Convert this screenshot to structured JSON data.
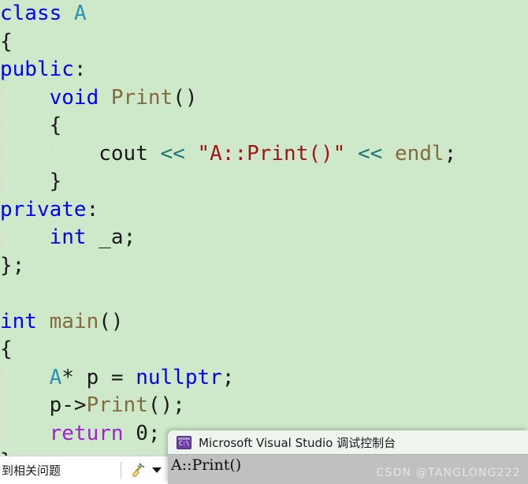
{
  "editor": {
    "background_color": "#cee9ca",
    "font_size_px": 26,
    "line_height_px": 35.5,
    "lines": [
      {
        "indent": 0,
        "tokens": [
          {
            "text": "class",
            "cls": "t-kw"
          },
          {
            "text": " ",
            "cls": "t-plain"
          },
          {
            "text": "A",
            "cls": "t-type"
          }
        ]
      },
      {
        "indent": 0,
        "tokens": [
          {
            "text": "{",
            "cls": "t-plain"
          }
        ]
      },
      {
        "indent": 0,
        "tokens": [
          {
            "text": "public",
            "cls": "t-kw"
          },
          {
            "text": ":",
            "cls": "t-plain"
          }
        ]
      },
      {
        "indent": 1,
        "tokens": [
          {
            "text": "void",
            "cls": "t-kw"
          },
          {
            "text": " ",
            "cls": "t-plain"
          },
          {
            "text": "Print",
            "cls": "t-fn"
          },
          {
            "text": "()",
            "cls": "t-plain"
          }
        ]
      },
      {
        "indent": 1,
        "tokens": [
          {
            "text": "{",
            "cls": "t-plain"
          }
        ]
      },
      {
        "indent": 2,
        "tokens": [
          {
            "text": "cout",
            "cls": "t-plain"
          },
          {
            "text": " ",
            "cls": "t-plain"
          },
          {
            "text": "<<",
            "cls": "t-op"
          },
          {
            "text": " ",
            "cls": "t-plain"
          },
          {
            "text": "\"A::Print()\"",
            "cls": "t-str"
          },
          {
            "text": " ",
            "cls": "t-plain"
          },
          {
            "text": "<<",
            "cls": "t-op"
          },
          {
            "text": " ",
            "cls": "t-plain"
          },
          {
            "text": "endl",
            "cls": "t-fn"
          },
          {
            "text": ";",
            "cls": "t-plain"
          }
        ]
      },
      {
        "indent": 1,
        "tokens": [
          {
            "text": "}",
            "cls": "t-plain"
          }
        ]
      },
      {
        "indent": 0,
        "tokens": [
          {
            "text": "private",
            "cls": "t-kw"
          },
          {
            "text": ":",
            "cls": "t-plain"
          }
        ]
      },
      {
        "indent": 1,
        "tokens": [
          {
            "text": "int",
            "cls": "t-kw"
          },
          {
            "text": " ",
            "cls": "t-plain"
          },
          {
            "text": "_a",
            "cls": "t-plain"
          },
          {
            "text": ";",
            "cls": "t-plain"
          }
        ]
      },
      {
        "indent": 0,
        "tokens": [
          {
            "text": "};",
            "cls": "t-plain"
          }
        ]
      },
      {
        "indent": 0,
        "tokens": []
      },
      {
        "indent": 0,
        "tokens": [
          {
            "text": "int",
            "cls": "t-kw"
          },
          {
            "text": " ",
            "cls": "t-plain"
          },
          {
            "text": "main",
            "cls": "t-fn"
          },
          {
            "text": "()",
            "cls": "t-plain"
          }
        ]
      },
      {
        "indent": 0,
        "tokens": [
          {
            "text": "{",
            "cls": "t-plain"
          }
        ]
      },
      {
        "indent": 1,
        "tokens": [
          {
            "text": "A",
            "cls": "t-type"
          },
          {
            "text": "* p = ",
            "cls": "t-plain"
          },
          {
            "text": "nullptr",
            "cls": "t-kw"
          },
          {
            "text": ";",
            "cls": "t-plain"
          }
        ]
      },
      {
        "indent": 1,
        "tokens": [
          {
            "text": "p->",
            "cls": "t-plain"
          },
          {
            "text": "Print",
            "cls": "t-fn"
          },
          {
            "text": "();",
            "cls": "t-plain"
          }
        ]
      },
      {
        "indent": 1,
        "tokens": [
          {
            "text": "return",
            "cls": "t-ctl"
          },
          {
            "text": " ",
            "cls": "t-plain"
          },
          {
            "text": "0",
            "cls": "t-num"
          },
          {
            "text": ";",
            "cls": "t-plain"
          }
        ]
      },
      {
        "indent": 0,
        "tokens": [
          {
            "text": "}",
            "cls": "t-plain"
          }
        ]
      }
    ]
  },
  "status_bar": {
    "message": "到相关问题",
    "quick_actions_icon": "broom-icon",
    "dropdown_icon": "chevron-down-icon"
  },
  "console_window": {
    "icon": "console-app-icon",
    "icon_glyph": "C:\\",
    "title": "Microsoft Visual Studio 调试控制台",
    "output": "A::Print()",
    "watermark": "CSDN @TANGLONG222"
  }
}
